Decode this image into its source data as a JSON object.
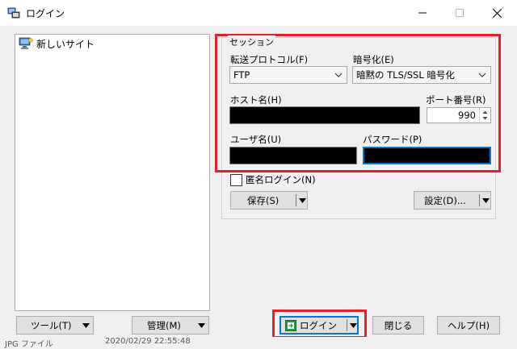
{
  "window": {
    "title": "ログイン"
  },
  "site_tree": {
    "items": [
      {
        "label": "新しいサイト"
      }
    ]
  },
  "session": {
    "group_label": "セッション",
    "protocol": {
      "label": "転送プロトコル(F)",
      "value": "FTP"
    },
    "encryption": {
      "label": "暗号化(E)",
      "value": "暗黙の TLS/SSL 暗号化"
    },
    "host": {
      "label": "ホスト名(H)"
    },
    "port": {
      "label": "ポート番号(R)",
      "value": "990"
    },
    "user": {
      "label": "ユーザ名(U)"
    },
    "password": {
      "label": "パスワード(P)"
    },
    "anonymous_label": "匿名ログイン(N)",
    "save_label": "保存(S)",
    "settings_label": "設定(D)..."
  },
  "buttons": {
    "tools": "ツール(T)",
    "manage": "管理(M)",
    "login": "ログイン",
    "close": "閉じる",
    "help": "ヘルプ(H)"
  },
  "background": {
    "file_type": "JPG ファイル",
    "date": "2020/02/29  22:55:48"
  },
  "colors": {
    "highlight_red": "#e0202a",
    "focus_blue": "#0078d7"
  },
  "icons": {
    "app": "winscp-icon",
    "site": "computer-icon",
    "login": "login-icon"
  }
}
